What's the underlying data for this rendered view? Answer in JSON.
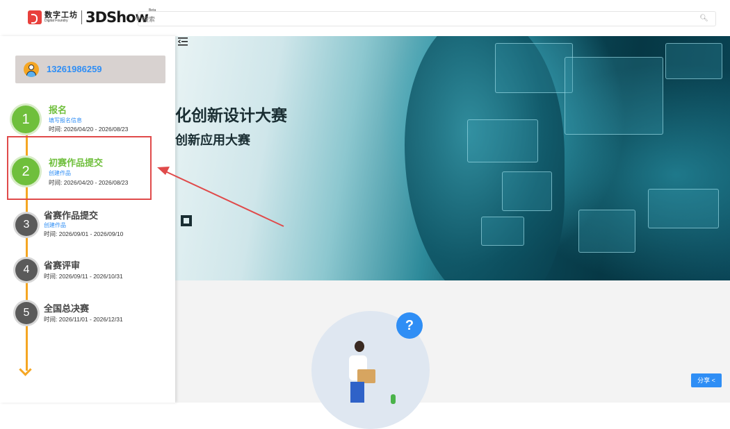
{
  "header": {
    "logo_cn": "数字工坊",
    "logo_en": "Digital Foundry",
    "logo_product": "3DShow",
    "logo_beta": "Beta",
    "search_placeholder": "搜索"
  },
  "user": {
    "phone": "13261986259"
  },
  "steps": [
    {
      "num": "1",
      "title": "报名",
      "link": "填写报名信息",
      "time": "时间: 2026/04/20 - 2026/08/23",
      "status": "done"
    },
    {
      "num": "2",
      "title": "初赛作品提交",
      "link": "创建作品",
      "time": "时间: 2026/04/20 - 2026/08/23",
      "status": "current"
    },
    {
      "num": "3",
      "title": "省赛作品提交",
      "link": "创建作品",
      "time": "时间: 2026/09/01 - 2026/09/10",
      "status": "upcoming"
    },
    {
      "num": "4",
      "title": "省赛评审",
      "link": "",
      "time": "时间: 2026/09/11 - 2026/10/31",
      "status": "upcoming"
    },
    {
      "num": "5",
      "title": "全国总决赛",
      "link": "",
      "time": "时间: 2026/11/01 - 2026/12/31",
      "status": "upcoming"
    }
  ],
  "hero": {
    "title_line1": "化创新设计大赛",
    "title_line2": "创新应用大赛"
  },
  "share": {
    "label": "分享 <"
  },
  "colors": {
    "accent_green": "#6fbf3c",
    "accent_blue": "#2f8ef5",
    "timeline_orange": "#f5a623",
    "highlight_red": "#e04a4a"
  }
}
